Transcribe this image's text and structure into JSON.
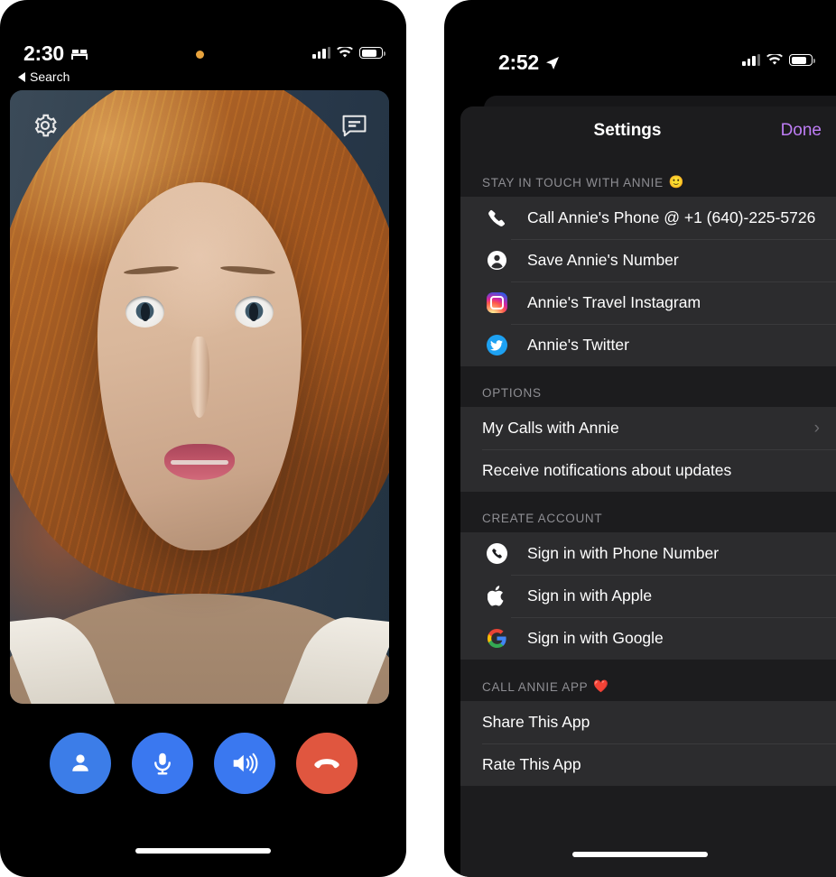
{
  "left_phone": {
    "status_bar": {
      "time": "2:30",
      "focus_icon": "bed-icon",
      "back_label": "Search",
      "back_icon": "triangle-left-icon",
      "recording_dot": "orange-privacy-dot",
      "signal_icon": "cellular-signal-icon",
      "wifi_icon": "wifi-icon",
      "battery_icon": "battery-icon"
    },
    "video": {
      "settings_icon": "gear-icon",
      "chat_icon": "chat-bubble-icon",
      "subject": "annie-video-portrait"
    },
    "controls": [
      {
        "name": "person-button",
        "icon": "person-icon",
        "color": "#3C7DE8"
      },
      {
        "name": "mute-button",
        "icon": "microphone-icon",
        "color": "#3A78F0"
      },
      {
        "name": "speaker-button",
        "icon": "speaker-icon",
        "color": "#3A78F0"
      },
      {
        "name": "end-call-button",
        "icon": "phone-down-icon",
        "color": "#E0563F"
      }
    ]
  },
  "right_phone": {
    "status_bar": {
      "time": "2:52",
      "location_icon": "location-arrow-icon",
      "signal_icon": "cellular-signal-icon",
      "wifi_icon": "wifi-icon",
      "battery_icon": "battery-icon"
    },
    "sheet": {
      "title": "Settings",
      "done_label": "Done",
      "done_color": "#BE7DF5",
      "sections": [
        {
          "header": "STAY IN TOUCH WITH ANNIE",
          "header_emoji": "🙂",
          "rows": [
            {
              "label": "Call Annie's Phone @ +1 (640)-225-5726",
              "icon": "phone-handset-icon"
            },
            {
              "label": "Save Annie's Number",
              "icon": "person-circle-icon"
            },
            {
              "label": "Annie's Travel Instagram",
              "icon": "instagram-icon"
            },
            {
              "label": "Annie's Twitter",
              "icon": "twitter-icon"
            }
          ]
        },
        {
          "header": "OPTIONS",
          "header_emoji": "",
          "rows": [
            {
              "label": "My Calls with Annie",
              "icon": "",
              "chevron": "›"
            },
            {
              "label": "Receive notifications about updates",
              "icon": ""
            }
          ]
        },
        {
          "header": "CREATE ACCOUNT",
          "header_emoji": "",
          "rows": [
            {
              "label": "Sign in with Phone Number",
              "icon": "phone-circle-icon"
            },
            {
              "label": "Sign in with Apple",
              "icon": "apple-icon"
            },
            {
              "label": "Sign in with Google",
              "icon": "google-icon"
            }
          ]
        },
        {
          "header": "CALL ANNIE APP",
          "header_emoji": "❤️",
          "rows": [
            {
              "label": "Share This App",
              "icon": ""
            },
            {
              "label": "Rate This App",
              "icon": ""
            }
          ]
        }
      ]
    }
  }
}
